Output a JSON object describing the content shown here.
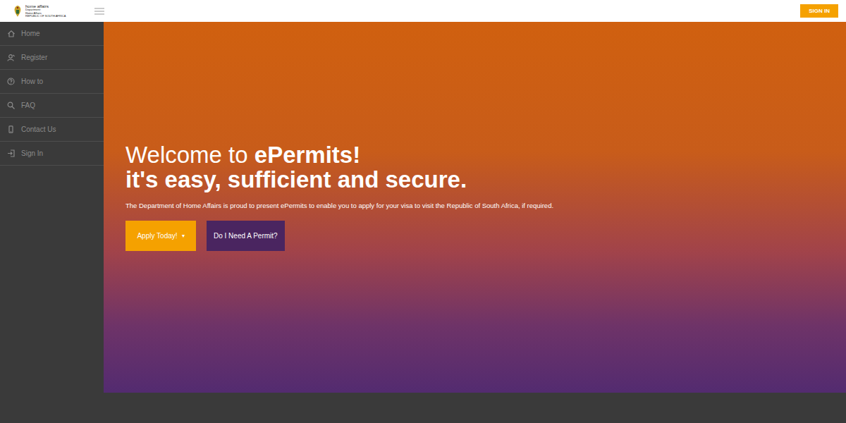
{
  "header": {
    "logo": {
      "title": "home affairs",
      "lines": [
        "Department:",
        "Home Affairs",
        "REPUBLIC OF SOUTH AFRICA"
      ]
    },
    "sign_in": "SIGN IN"
  },
  "sidebar": {
    "items": [
      {
        "label": "Home",
        "selected": false
      },
      {
        "label": "Register",
        "selected": false
      },
      {
        "label": "How to",
        "selected": false
      },
      {
        "label": "FAQ",
        "selected": false
      },
      {
        "label": "Contact Us",
        "selected": false
      },
      {
        "label": "Sign In",
        "selected": false
      }
    ]
  },
  "hero": {
    "title_light": "Welcome to",
    "title_bold": "ePermits!",
    "subtitle": "it's easy, sufficient and secure.",
    "text": "The Department of Home Affairs is proud to present ePermits to enable you to apply for your visa to visit the Republic of South Africa, if required.",
    "apply_button": {
      "label": "Apply Today!",
      "caret": "▾"
    },
    "permit_button": {
      "label": "Do I Need A Permit?"
    }
  }
}
